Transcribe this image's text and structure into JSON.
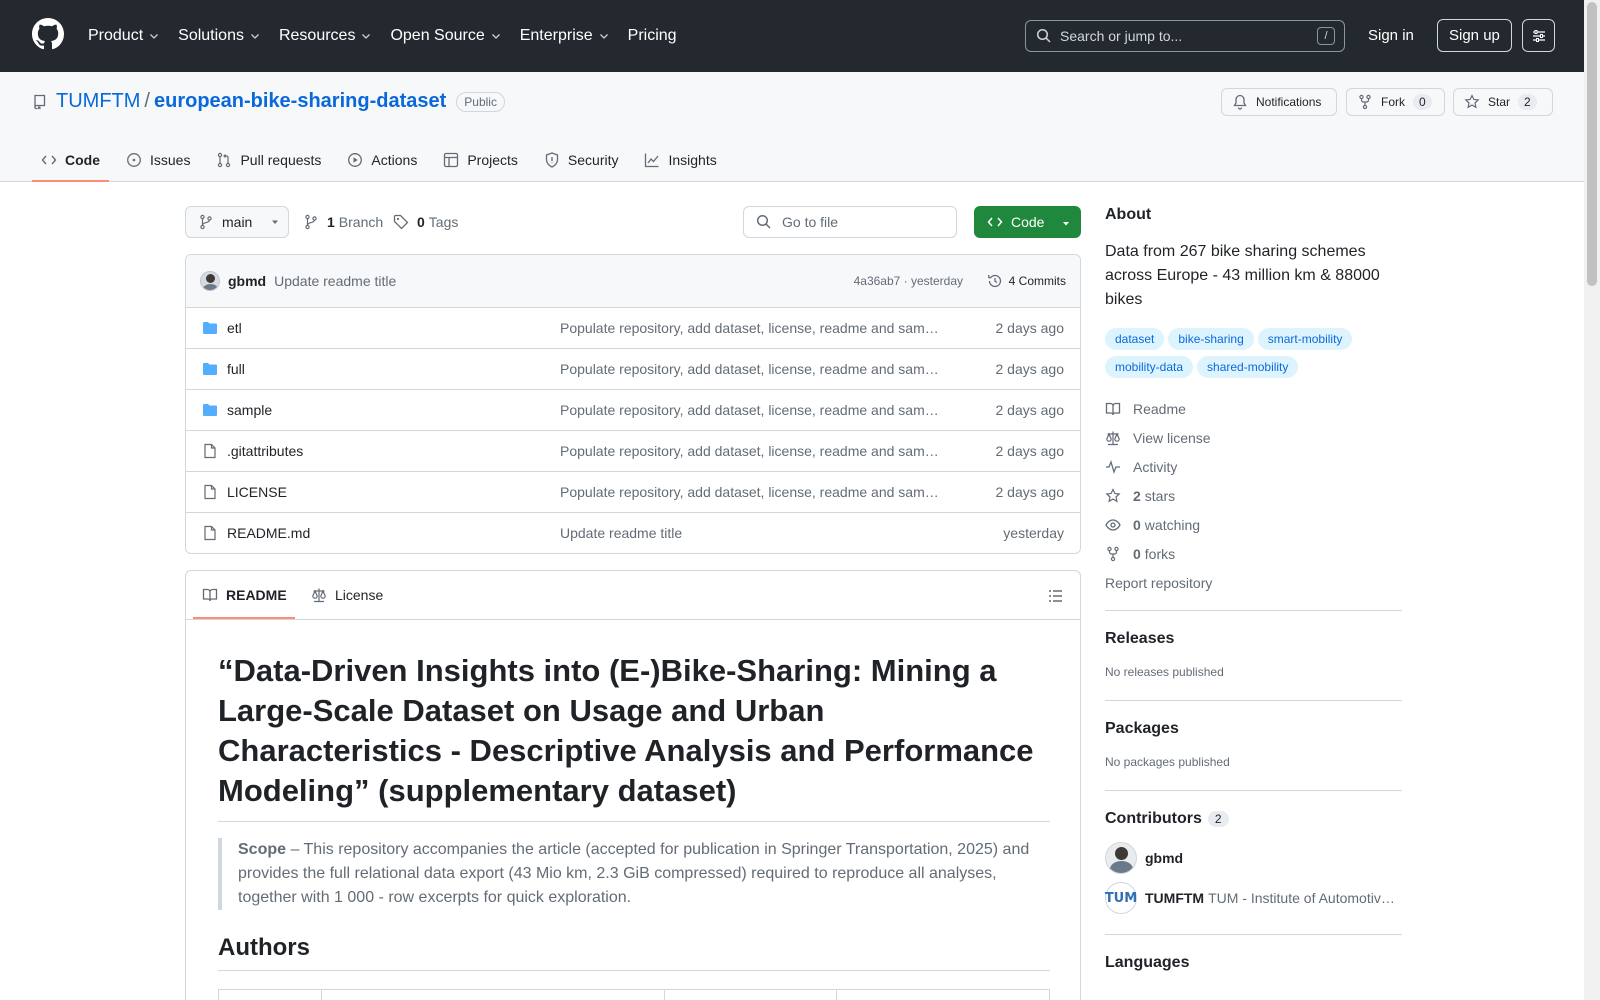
{
  "topbar": {
    "nav": [
      "Product",
      "Solutions",
      "Resources",
      "Open Source",
      "Enterprise",
      "Pricing"
    ],
    "search_placeholder": "Search or jump to...",
    "search_shortcut": "/",
    "signin": "Sign in",
    "signup": "Sign up"
  },
  "repo": {
    "owner": "TUMFTM",
    "separator": "/",
    "name": "european-bike-sharing-dataset",
    "visibility": "Public",
    "notifications": "Notifications",
    "fork_label": "Fork",
    "fork_count": "0",
    "star_label": "Star",
    "star_count": "2",
    "tabs": [
      "Code",
      "Issues",
      "Pull requests",
      "Actions",
      "Projects",
      "Security",
      "Insights"
    ]
  },
  "branchbar": {
    "branch": "main",
    "branch_count": "1",
    "branch_label": "Branch",
    "tag_count": "0",
    "tag_label": "Tags",
    "goto_file": "Go to file",
    "code_button": "Code"
  },
  "commit": {
    "author": "gbmd",
    "message": "Update readme title",
    "hash_and_time": "4a36ab7 · yesterday",
    "commits": "4 Commits"
  },
  "files": [
    {
      "name": "etl",
      "type": "folder",
      "commit": "Populate repository, add dataset, license, readme and samples",
      "age": "2 days ago"
    },
    {
      "name": "full",
      "type": "folder",
      "commit": "Populate repository, add dataset, license, readme and samples",
      "age": "2 days ago"
    },
    {
      "name": "sample",
      "type": "folder",
      "commit": "Populate repository, add dataset, license, readme and samples",
      "age": "2 days ago"
    },
    {
      "name": ".gitattributes",
      "type": "file",
      "commit": "Populate repository, add dataset, license, readme and samples",
      "age": "2 days ago"
    },
    {
      "name": "LICENSE",
      "type": "file",
      "commit": "Populate repository, add dataset, license, readme and samples",
      "age": "2 days ago"
    },
    {
      "name": "README.md",
      "type": "file",
      "commit": "Update readme title",
      "age": "yesterday"
    }
  ],
  "readme": {
    "tab_readme": "README",
    "tab_license": "License",
    "title": "“Data-Driven Insights into (E-)Bike-Sharing: Mining a Large-Scale Dataset on Usage and Urban Characteristics - Descriptive Analysis and Performance Modeling” (supplementary dataset)",
    "scope_label": "Scope",
    "scope_text": " – This repository accompanies the article (accepted for publication in Springer Transportation, 2025) and provides the full relational data export (43 Mio km, 2.3 GiB compressed) required to reproduce all analyses, together with 1 000 - row excerpts for quick exploration.",
    "authors_heading": "Authors"
  },
  "sidebar": {
    "about_title": "About",
    "description": "Data from 267 bike sharing schemes across Europe - 43 million km & 88000 bikes",
    "topics": [
      "dataset",
      "bike-sharing",
      "smart-mobility",
      "mobility-data",
      "shared-mobility"
    ],
    "links": {
      "readme": "Readme",
      "license": "View license",
      "activity": "Activity",
      "stars_count": "2",
      "stars_label": "stars",
      "watching_count": "0",
      "watching_label": "watching",
      "forks_count": "0",
      "forks_label": "forks",
      "report": "Report repository"
    },
    "releases_title": "Releases",
    "releases_empty": "No releases published",
    "packages_title": "Packages",
    "packages_empty": "No packages published",
    "contributors_title": "Contributors",
    "contributors_count": "2",
    "contributors": [
      {
        "login": "gbmd",
        "full_name": ""
      },
      {
        "login": "TUMFTM",
        "full_name": "TUM - Institute of Automotive Technology"
      }
    ],
    "tum_logo_text": "TUM",
    "languages_title": "Languages"
  },
  "colors": {
    "accent": "#0969da",
    "green": "#1f883d",
    "header": "#24292f",
    "tab_underline": "#fd8c73"
  }
}
